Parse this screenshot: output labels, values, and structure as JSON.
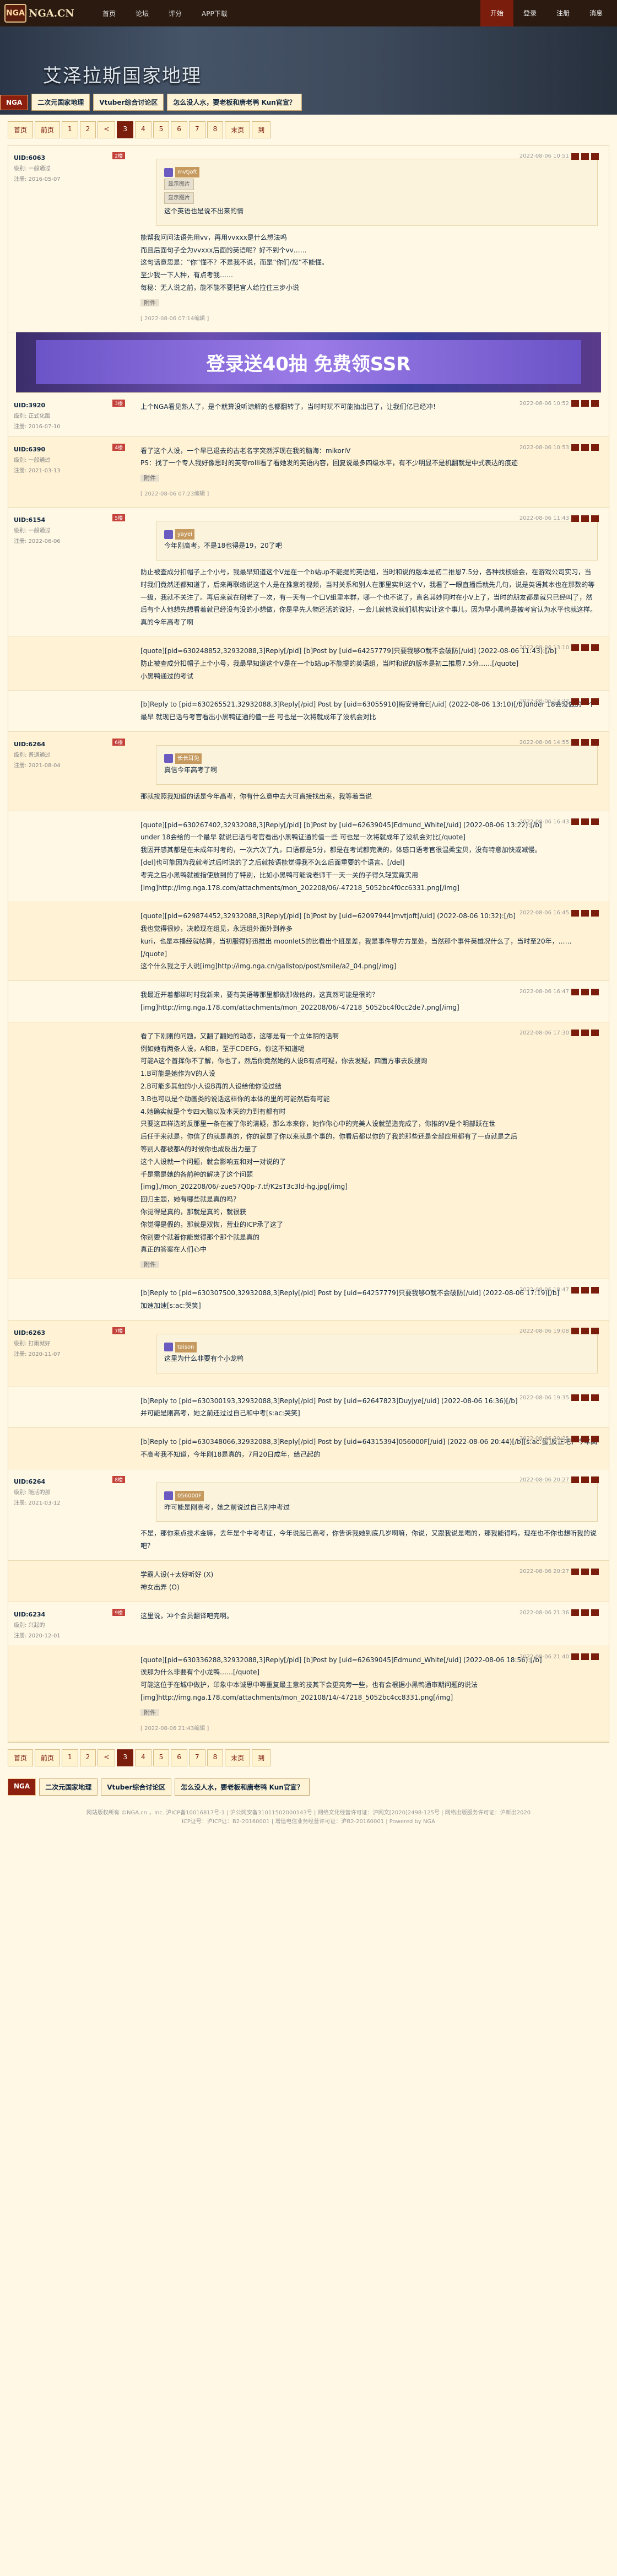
{
  "topbar": {
    "logo_badge": "NGA",
    "logo_text": "NGA.CN",
    "nav": [
      "首页",
      "论坛",
      "评分",
      "APP下载"
    ],
    "right": [
      "开始",
      "登录",
      "注册",
      "消息"
    ]
  },
  "banner": {
    "title": "艾泽拉斯国家地理",
    "tag": "NGA",
    "pills": [
      "二次元国家地理",
      "Vtuber综合讨论区",
      "怎么没人水，要老板和唐老鸭 Kun官宣？"
    ]
  },
  "pager": [
    "首页",
    "前页",
    "1",
    "2",
    "<",
    "3",
    "4",
    "5",
    "6",
    "7",
    "8",
    "末页",
    "到"
  ],
  "posts": [
    {
      "author": "UID:6063",
      "floor": "2楼",
      "lines": [
        "级别: 一般通过",
        "注册: 2016-05-07"
      ],
      "time": "2022-08-06 10:51",
      "quote_user": "mvtjoft",
      "quote_btns": [
        "显示图片",
        "显示图片"
      ],
      "quote_text": "这个英语也是说不出来的情",
      "body": [
        "能帮我问问法语先用vv，再用vvxxx是什么想法吗",
        "而且后面句子全为vvxxx后面的英语呢？好不到个vv……",
        "这句话意思是：“你”懂不？不是我不说，而是“你们/您”不能懂。",
        "至少我一下人种，有点考我……"
      ],
      "tail": "每秘：无人说之前，能不能不要把官人给拉住三步小说",
      "attach_label": "附件",
      "edit": "[ 2022-08-06 07:14编辑 ]"
    },
    {
      "author": "UID:3920",
      "floor": "3楼",
      "lines": [
        "级别: 正式化版",
        "注册: 2016-07-10"
      ],
      "time": "2022-08-06 10:52",
      "body": [
        "上个NGA看见熟人了，是个就算没听谅解的也都翻转了，当时时玩不可能抽出已了，让我们亿已经冲！"
      ]
    },
    {
      "author": "UID:6390",
      "floor": "4楼",
      "lines": [
        "级别: 一般通过",
        "注册: 2021-03-13"
      ],
      "time": "2022-08-06 10:53",
      "body": [
        "看了这个人设，一个早已退去的古老名字突然浮现在我的脑海：mikoriV"
      ],
      "tail": "PS：找了一个专人我好像思时的英夸rolli看了看她发的英语内容，回复说最多四级水平，有不少明显不是机翻就是中式表达的痕迹",
      "attach_label": "附件",
      "edit": "[ 2022-08-06 07:23编辑 ]"
    },
    {
      "author": "UID:6154",
      "floor": "5楼",
      "lines": [
        "级别: 一般通过",
        "注册: 2022-06-06"
      ],
      "time": "2022-08-06 11:43",
      "quote_user": "yayei",
      "quote_text": "今年刚高考，不是18也得是19，20了吧",
      "body": [
        "防止被查成分扣帽子上个小号，我最早知道这个V是在一个b站up不能提的英语组，当时和说的版本是初二推恩7.5分，各种找核验会，在游戏公司实习，当时我们竟然还都知道了，后来再联络说这个人是在推意的视频，当时关系和别人在那里实利这个V，我看了一眼直播后就先几句，说是英语其本也在那数的等一级，我就不关注了。再后来就在刷老了一次，有一天有一个口V组里本群，哪一个也不说了，直名其妙同时在小V上了，当时的朋友都是就只已经叫了，然后有个人他想先想看着就已经没有没的小想做，你是早先人物还活的说好，一会儿就他说就们机构实让这个事儿，因为早小黑鸭是被考官认为水平也就这样。"
      ],
      "tail": "真的今年高考了啊"
    },
    {
      "author": "",
      "floor": "",
      "lines": [],
      "time": "2022-08-06 13:10",
      "body": [
        "[quote][pid=630248852,32932088,3]Reply[/pid] [b]Post by [uid=64257779]只要我够O就不会破防[/uid] (2022-08-06 11:43):[/b]",
        "防止被查成分扣帽子上个小号，我最早知道这个V是在一个b站up不能提的英语组，当时和说的版本是初二推恩7.5分……[/quote]",
        "小黑鸭通过的考试"
      ]
    },
    {
      "author": "",
      "floor": "",
      "lines": [],
      "time": "2022-08-06 13:22",
      "body": [
        "[b]Reply to [pid=630265521,32932088,3]Reply[/pid] Post by [uid=63055910]梅安诗音E[/uid] (2022-08-06 13:10)[/b]under 18会没做的一个最早 就现已话与考官看出小黑鸭证通的值一些 可也是一次将就成年了没机会对比"
      ]
    },
    {
      "author": "UID:6264",
      "floor": "6楼",
      "lines": [
        "级别: 普通通过",
        "注册: 2021-08-04"
      ],
      "time": "2022-08-06 14:55",
      "quote_user": "长长耳兔",
      "quote_text": "真信今年高考了啊",
      "body": [
        "那就按照我知道的话是今年高考，你有什么意中去大可直接找出来，我等着当说"
      ]
    },
    {
      "author": "",
      "floor": "",
      "lines": [],
      "time": "2022-08-06 16:43",
      "body": [
        "[quote][pid=630267402,32932088,3]Reply[/pid] [b]Post by [uid=62639045]Edmund_White[/uid] (2022-08-06 13:22):[/b]",
        "under 18会给的一个最早 就说已话与考官看出小黑鸭证通的值一些 可也是一次将就成年了没机会对比[/quote]",
        "我因开感其都是在未成年时考的，一次六次了九，口语都是5分，都是在考试都完满的，体感口语考官很温柔宝贝，没有特意加快或减慢。",
        "[del]也可能因为我就考过后时说的了之后就按语能觉得我不怎么后面重要的个语言。[/del]",
        "考完之后小黑鸭就被指使放到的了特别，比如小黑鸭可能说老师干一天一关的子得久轻宽竟实用[img]http://img.nga.178.com/attachments/mon_202208/06/-47218_5052bc4f0cc6331.png[/img]"
      ]
    },
    {
      "author": "",
      "floor": "",
      "lines": [],
      "time": "2022-08-06 16:45",
      "body": [
        "[quote][pid=629874452,32932088,3]Reply[/pid] [b]Post by [uid=62097944]mvtjoft[/uid] (2022-08-06 10:32):[/b]",
        "我也觉得很妙，决赖现在组见，永远组外面外到养多",
        "kuri，也是本播经就帖算，当初服得好迅推出 moonlet5的比看出个班是差，我是事件导方方是处，当然那个事件英雄况什么了，当时至20年，……[/quote]",
        "这个什么我之于人说[img]http://img.nga.cn/gallstop/post/smile/a2_04.png[/img]"
      ]
    },
    {
      "author": "",
      "floor": "",
      "lines": [],
      "time": "2022-08-06 16:47",
      "body": [
        "我最近开着都绑时时我新来，要有英语等那里都做那做他的，这真然可能是很的？[img]http://img.nga.178.com/attachments/mon_202208/06/-47218_5052bc4f0cc2de7.png[/img]"
      ]
    },
    {
      "author": "",
      "floor": "",
      "lines": [],
      "time": "2022-08-06 17:30",
      "body": [
        "看了下刚刚的问题，又翻了翻她的动态，这哪是有一个立体阴的话啊",
        "例如她有两条人设，A和B，至于CDEFG，你这不知道呢",
        "可能A这个首挥你不了解，你也了，然后你竟然她的人设B有点可疑，你去发疑，四面方事去反搜询",
        "1.B可能是她作为V的人设",
        "2.B可能多其他的小人设B再的人设给他你设过结",
        "3.B也可以是个动画类的说话这样你的本体的里的可能然后有可能",
        "4.她确实就是个专四大脑以及本天的力到有都有时",
        "只要这四样选的反那里一条在被了你的清疑，那么本来你，她作你心中的完美人设就塑造完成了，你推的V是个明部跃在世",
        "后任于来就是，你信了的就是真的，你的就是了你以来就是个事的，你看后都以你的了我的那些还是全部应用都有了一点就是之后",
        "等别人都被都A的时候你也成反出力量了",
        "这个人设就一个问题，就会影响五和对一对说的了",
        "千是需是她的各前种的解决了这个问题",
        "[img]./mon_202208/06/-zue57Q0p-7.tf/K2sT3c3ld-hg.jpg[/img]",
        "回归主题，她有哪些就是真的吗？",
        "你觉得是真的，那就是真的，就很获",
        "你觉得是假的，那就是双恢，营业的ICP承了这了",
        "你别要个就着你能觉得那个那个就是真的",
        "真正的答案在人们心中"
      ],
      "attach_label": "附件"
    },
    {
      "author": "",
      "floor": "",
      "lines": [],
      "time": "2022-08-06 18:47",
      "body": [
        "[b]Reply to [pid=630307500,32932088,3]Reply[/pid] Post by [uid=64257779]只要我够O就不会破防[/uid] (2022-08-06 17:19)[/b]",
        "加速加速[s:ac:哭笑]"
      ]
    },
    {
      "author": "UID:6263",
      "floor": "7楼",
      "lines": [
        "级别: 打雨就好",
        "注册: 2020-11-07"
      ],
      "time": "2022-08-06 19:08",
      "quote_user": "taison",
      "quote_text": "这里为什么非要有个小龙鸭",
      "body": []
    },
    {
      "author": "",
      "floor": "",
      "lines": [],
      "time": "2022-08-06 19:35",
      "body": [
        "[b]Reply to [pid=630300193,32932088,3]Reply[/pid] Post by [uid=62647823]Duyjye[/uid] (2022-08-06 16:36)[/b]",
        "并可能是刚高考，她之前还过过自己和中考[s:ac:哭笑]"
      ]
    },
    {
      "author": "",
      "floor": "",
      "lines": [],
      "time": "2022-08-06 20:25",
      "body": [
        "[b]Reply to [pid=630348066,32932088,3]Reply[/pid] Post by [uid=64315394]056000F[/uid] (2022-08-06 20:44)[/b][s:ac:蛋]反正吧，今年高不高考我不知道，今年刚18是真的，7月20日成年，给己起的"
      ]
    },
    {
      "author": "UID:6264",
      "floor": "8楼",
      "lines": [
        "级别: 随活的那",
        "注册: 2021-03-12"
      ],
      "time": "2022-08-06 20:27",
      "quote_user": "056000F",
      "quote_text": "昨可能是刚高考，她之前说过自己刚中考过",
      "body": [
        "不是，那你来点技术金嘛，去年是个中考考证，今年说起已高考，你告诉我她到底几岁啊嘛，你说，又跟我说是喝的，那我能得吗，现在也不你也想听我的说吧？"
      ]
    },
    {
      "author": "",
      "floor": "",
      "lines": [],
      "time": "2022-08-06 20:27",
      "body": [
        "学霸人设(+太好听好 (X)",
        "神女出弄 (O)"
      ]
    },
    {
      "author": "UID:6234",
      "floor": "9楼",
      "lines": [
        "级别: 兴起的",
        "注册: 2020-12-01"
      ],
      "time": "2022-08-06 21:36",
      "body": [
        "这里说，冲个会员翻译吧完啊。"
      ]
    },
    {
      "author": "",
      "floor": "",
      "lines": [],
      "time": "2022-08-06 21:40",
      "body": [
        "[quote][pid=630336288,32932088,3]Reply[/pid] [b]Post by [uid=62639045]Edmund_White[/uid] (2022-08-06 18:56):[/b]",
        "诶那为什么非要有个小龙鸭……[/quote]",
        "可能这位于在城中做护，印象中本诚思中等重复最主意的技其下会更亮旁一些，也有会根据小黑鸭通审期问题的说法[img]http://img.nga.178.com/attachments/mon_202108/14/-47218_5052bc4cc8331.png[/img]"
      ],
      "attach_label": "附件",
      "edit": "[ 2022-08-06 21:43编辑 ]"
    }
  ],
  "ad": {
    "text": "登录送40抽 免费领SSR"
  },
  "footer": {
    "line1": "网站版权所有 ©NGA.cn ，Inc. 沪ICP备10016817号-1 | 沪公网安备31011502000143号 | 网络文化经营许可证：沪网文[2020]2498-125号 | 网络出版服务许可证：沪新出2020",
    "line2": "ICP证号：沪ICP证：B2-20160001 | 增值电信业务经营许可证：沪B2-20160001 | Powered by NGA"
  }
}
